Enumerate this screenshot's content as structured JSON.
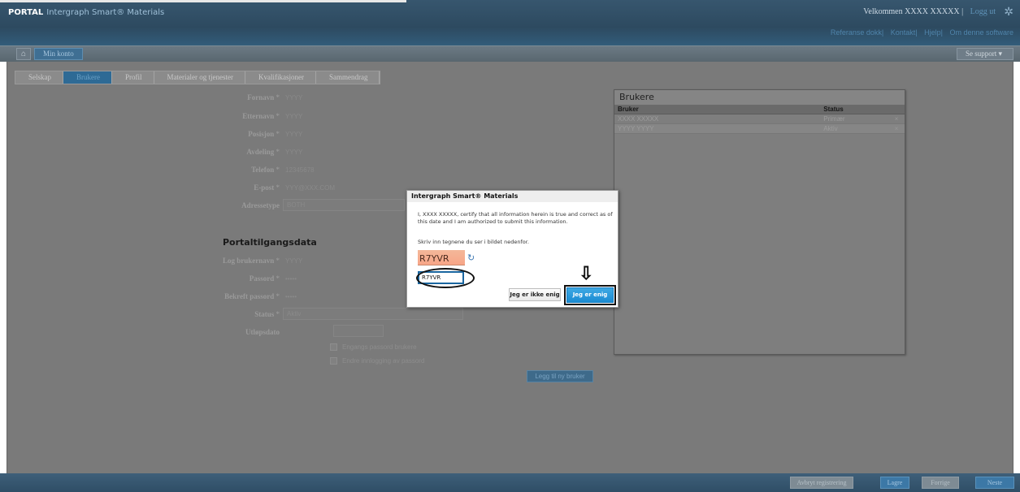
{
  "header": {
    "brand": "PORTAL",
    "product": "Intergraph Smart® Materials",
    "welcome": "Velkommen XXXX XXXXX",
    "separator": "|",
    "logout": "Logg ut",
    "links": [
      "Referanse dokk",
      "Kontakt",
      "Hjelp",
      "Om denne software"
    ]
  },
  "toolbar": {
    "my_account": "Min konto",
    "support": "Se support"
  },
  "steps": [
    "Selskap",
    "Brukere",
    "Profil",
    "Materialer og tjenester",
    "Kvalifikasjoner",
    "Sammendrag"
  ],
  "form": {
    "fields": [
      {
        "label": "Fornavn",
        "value": "YYYY"
      },
      {
        "label": "Etternavn",
        "value": "YYYY"
      },
      {
        "label": "Posisjon",
        "value": "YYYY"
      },
      {
        "label": "Avdeling",
        "value": "YYYY"
      },
      {
        "label": "Telefon",
        "value": "12345678"
      },
      {
        "label": "E-post",
        "value": "YYY@XXX.COM"
      },
      {
        "label": "Adressetype",
        "value": "BOTH"
      }
    ],
    "required_mark": "*",
    "section_title": "Portaltilgangsdata",
    "access_fields": [
      {
        "label": "Log brukernavn",
        "value": "YYYY"
      },
      {
        "label": "Passord",
        "value": "•••••"
      },
      {
        "label": "Bekreft passord",
        "value": "•••••"
      },
      {
        "label": "Status",
        "value": "Aktiv"
      },
      {
        "label": "Utløpsdato",
        "value": ""
      }
    ],
    "checkboxes": [
      "Engangs passord brukere",
      "Endre innlogging av passord"
    ],
    "add_button": "Legg til ny bruker"
  },
  "users_panel": {
    "title": "Brukere",
    "columns": [
      "Bruker",
      "Status"
    ],
    "rows": [
      {
        "user": "XXXX XXXXX",
        "status": "Primær"
      },
      {
        "user": "YYYY YYYY",
        "status": "Aktiv"
      }
    ],
    "delete_icon": "×"
  },
  "dialog": {
    "title": "Intergraph Smart® Materials",
    "certify_text": "I, XXXX XXXXX, certify that all information herein is true and correct as of this date and I am authorized to submit this information.",
    "prompt": "Skriv inn tegnene du ser i bildet nedenfor.",
    "captcha_text": "R7YVR",
    "captcha_input": "R7YVR",
    "disagree_button": "Jeg er ikke enig",
    "agree_button": "Jeg er enig",
    "arrow_icon": "⇩"
  },
  "footer": {
    "cancel": "Avbryt registrering",
    "save": "Lagre",
    "previous": "Forrige",
    "next": "Neste"
  }
}
